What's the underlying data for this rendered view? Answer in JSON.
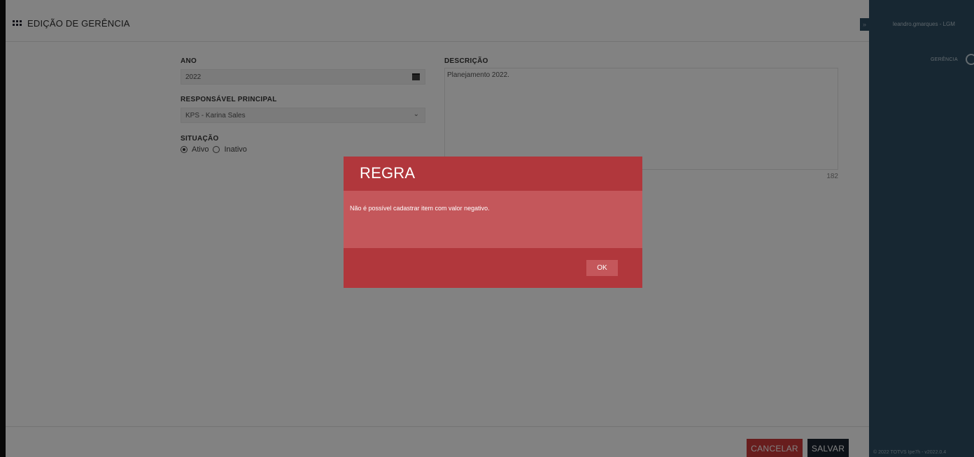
{
  "header": {
    "title": "EDIÇÃO DE GERÊNCIA"
  },
  "form": {
    "ano": {
      "label": "ANO",
      "value": "2022"
    },
    "responsavel": {
      "label": "RESPONSÁVEL PRINCIPAL",
      "value": "KPS - Karina Sales"
    },
    "situacao": {
      "label": "SITUAÇÃO",
      "options": [
        "Ativo",
        "Inativo"
      ],
      "selected": "Ativo"
    },
    "descricao": {
      "label": "DESCRIÇÃO",
      "value": "Planejamento 2022.",
      "remaining": "182"
    }
  },
  "footer": {
    "cancel_label": "CANCELAR",
    "save_label": "SALVAR"
  },
  "sidebar": {
    "toggle": "»",
    "user": "leandro.gmarques - LGM",
    "menu_item": "GERÊNCIA",
    "copyright": "© 2022 TOTVS Ipe7h - v2022.0.4"
  },
  "modal": {
    "title": "REGRA",
    "message": "Não é possível cadastrar item com valor negativo.",
    "ok_label": "OK"
  },
  "colors": {
    "sidebar_bg": "#2e4e62",
    "modal_header": "#b1373c",
    "modal_body": "#c4575b",
    "cancel_button": "#cc3a3a",
    "save_button": "#1a2530"
  }
}
